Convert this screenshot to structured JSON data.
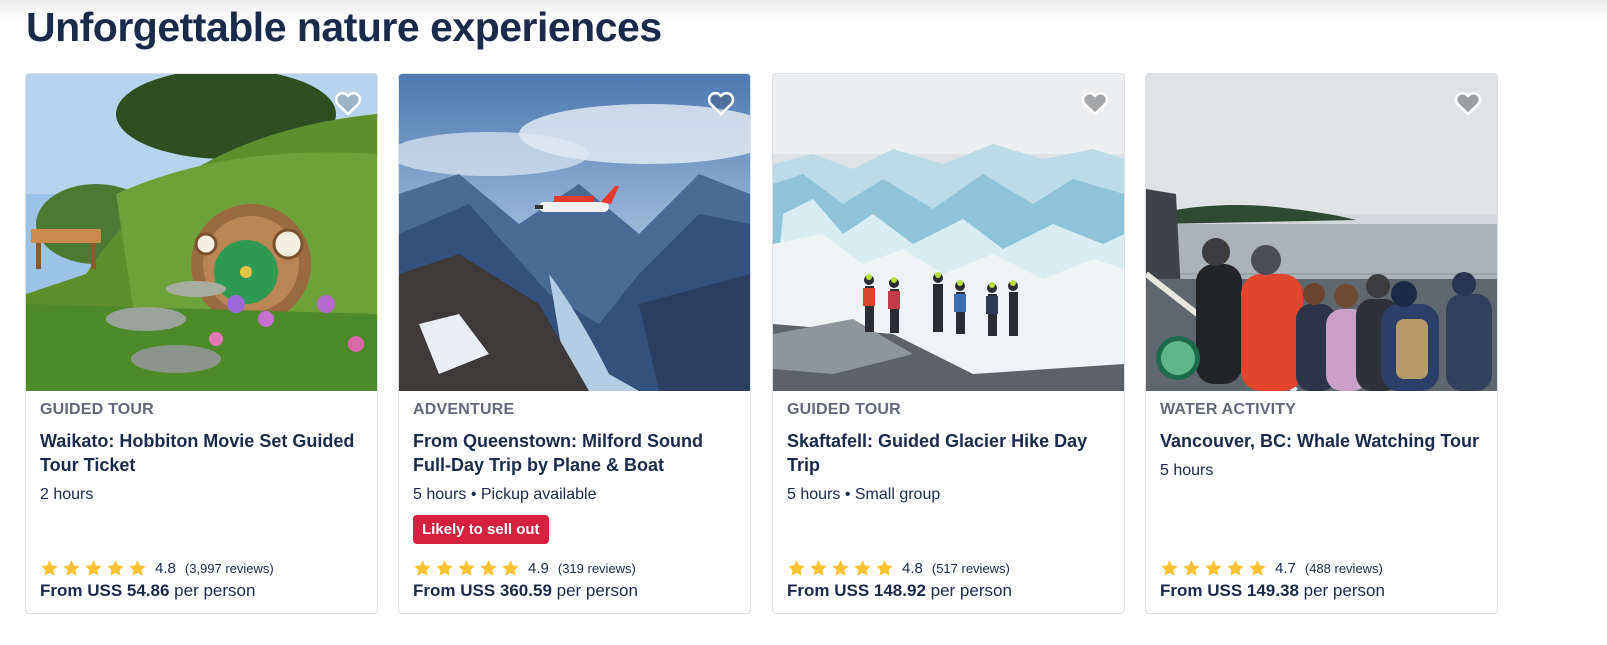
{
  "section": {
    "title": "Unforgettable nature experiences"
  },
  "colors": {
    "star": "#fcc22f",
    "badge": "#d6203f",
    "text": "#1a2b49",
    "category": "#63687a"
  },
  "cards": [
    {
      "category": "GUIDED TOUR",
      "title": "Waikato: Hobbiton Movie Set Guided Tour Ticket",
      "meta": "2 hours",
      "badge": "",
      "rating": "4.8",
      "reviews": "(3,997 reviews)",
      "price_prefix": "From USS 54.86",
      "price_suffix": " per person",
      "stars": 5,
      "image": "hobbit-hole"
    },
    {
      "category": "ADVENTURE",
      "title": "From Queenstown: Milford Sound Full-Day Trip by Plane & Boat",
      "meta": "5 hours • Pickup available",
      "badge": "Likely to sell out",
      "rating": "4.9",
      "reviews": "(319 reviews)",
      "price_prefix": "From USS 360.59",
      "price_suffix": " per person",
      "stars": 5,
      "image": "fjord-plane"
    },
    {
      "category": "GUIDED TOUR",
      "title": "Skaftafell: Guided Glacier Hike Day Trip",
      "meta": "5 hours • Small group",
      "badge": "",
      "rating": "4.8",
      "reviews": "(517 reviews)",
      "price_prefix": "From USS 148.92",
      "price_suffix": " per person",
      "stars": 5,
      "image": "glacier-hikers"
    },
    {
      "category": "WATER ACTIVITY",
      "title": "Vancouver, BC: Whale Watching Tour",
      "meta": "5 hours",
      "badge": "",
      "rating": "4.7",
      "reviews": "(488 reviews)",
      "price_prefix": "From USS 149.38",
      "price_suffix": " per person",
      "stars": 5,
      "image": "boat-passengers"
    }
  ]
}
